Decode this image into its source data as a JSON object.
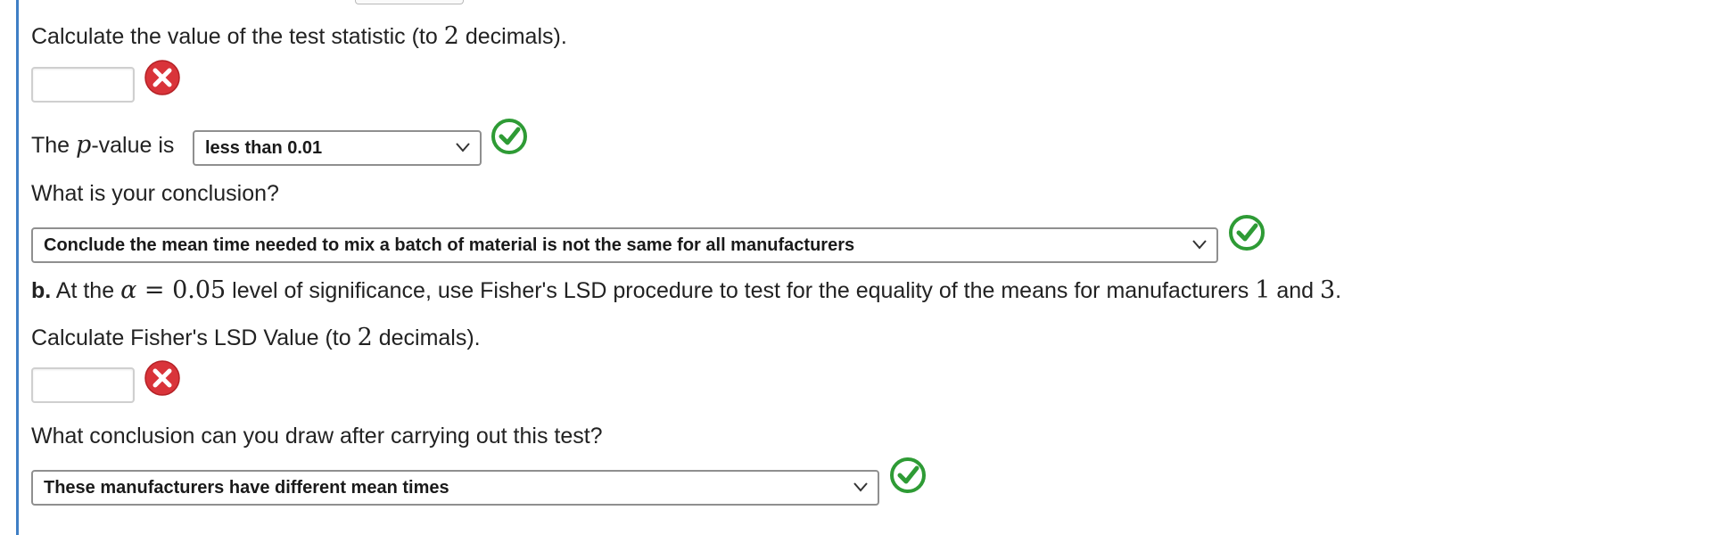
{
  "question_test_statistic": {
    "prefix": "Calculate the value of the test statistic (to ",
    "number": "2",
    "suffix": " decimals).",
    "input_value": "",
    "status_icon": "x-error-icon"
  },
  "p_value": {
    "prefix": "The ",
    "variable": "p",
    "suffix": "-value is",
    "selected_option": "less than 0.01",
    "status_icon": "check-correct-icon"
  },
  "conclusion_question": {
    "text": "What is your conclusion?",
    "selected_option": "Conclude the mean time needed to mix a batch of material is not the same for all manufacturers",
    "status_icon": "check-correct-icon"
  },
  "part_b": {
    "label": "b.",
    "text_1": " At the ",
    "alpha": "α",
    "equals": " = ",
    "alpha_value": "0.05",
    "text_2": " level of significance, use Fisher's LSD procedure to test for the equality of the means for manufacturers ",
    "m1": "1",
    "and": " and ",
    "m2": "3",
    "end": "."
  },
  "lsd_question": {
    "prefix": "Calculate Fisher's LSD Value (to ",
    "number": "2",
    "suffix": " decimals).",
    "input_value": "",
    "status_icon": "x-error-icon"
  },
  "lsd_conclusion": {
    "text": "What conclusion can you draw after carrying out this test?",
    "selected_option": "These manufacturers have different mean times",
    "status_icon": "check-correct-icon"
  },
  "colors": {
    "accent_rule": "#3f7fc5",
    "error_red": "#d9343a",
    "correct_green": "#2e9b35"
  }
}
